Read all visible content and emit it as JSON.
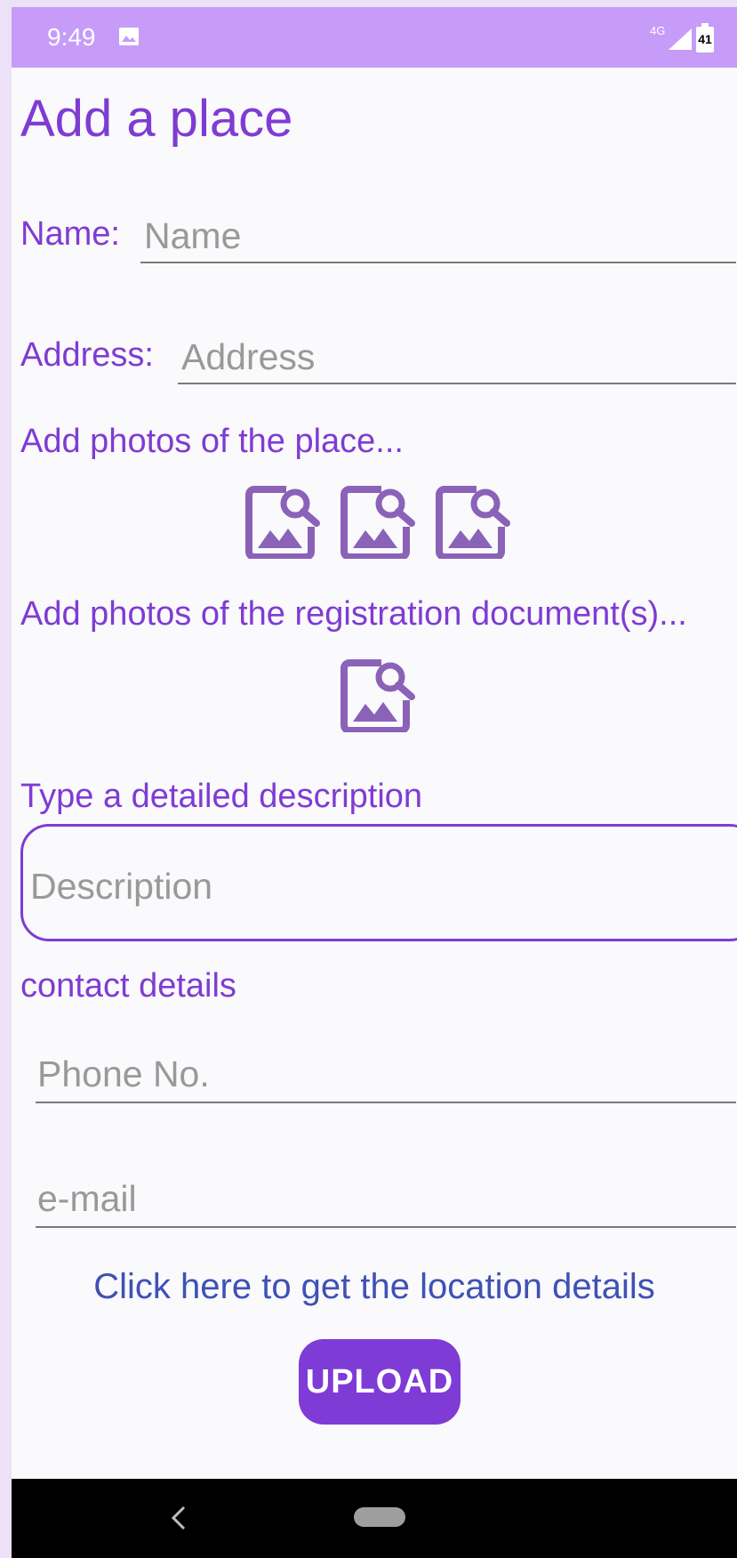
{
  "status_bar": {
    "time": "9:49",
    "network": "4G",
    "battery": "41"
  },
  "page": {
    "title": "Add a place"
  },
  "form": {
    "name_label": "Name:",
    "name_placeholder": "Name",
    "address_label": "Address:",
    "address_placeholder": "Address",
    "place_photos_label": "Add photos of the place...",
    "doc_photos_label": "Add photos of the registration document(s)...",
    "description_label": "Type a detailed description",
    "description_placeholder": "Description",
    "contact_label": "contact details",
    "phone_placeholder": "Phone No.",
    "email_placeholder": "e-mail",
    "location_link": "Click here to get the location details",
    "upload_button": "UPLOAD"
  },
  "icons": {
    "photo": "image-search-icon",
    "back": "back-icon"
  },
  "colors": {
    "accent": "#7e3cd3",
    "status_bar": "#c69cf8",
    "icon": "#8a62b8",
    "link": "#3f51b5"
  }
}
